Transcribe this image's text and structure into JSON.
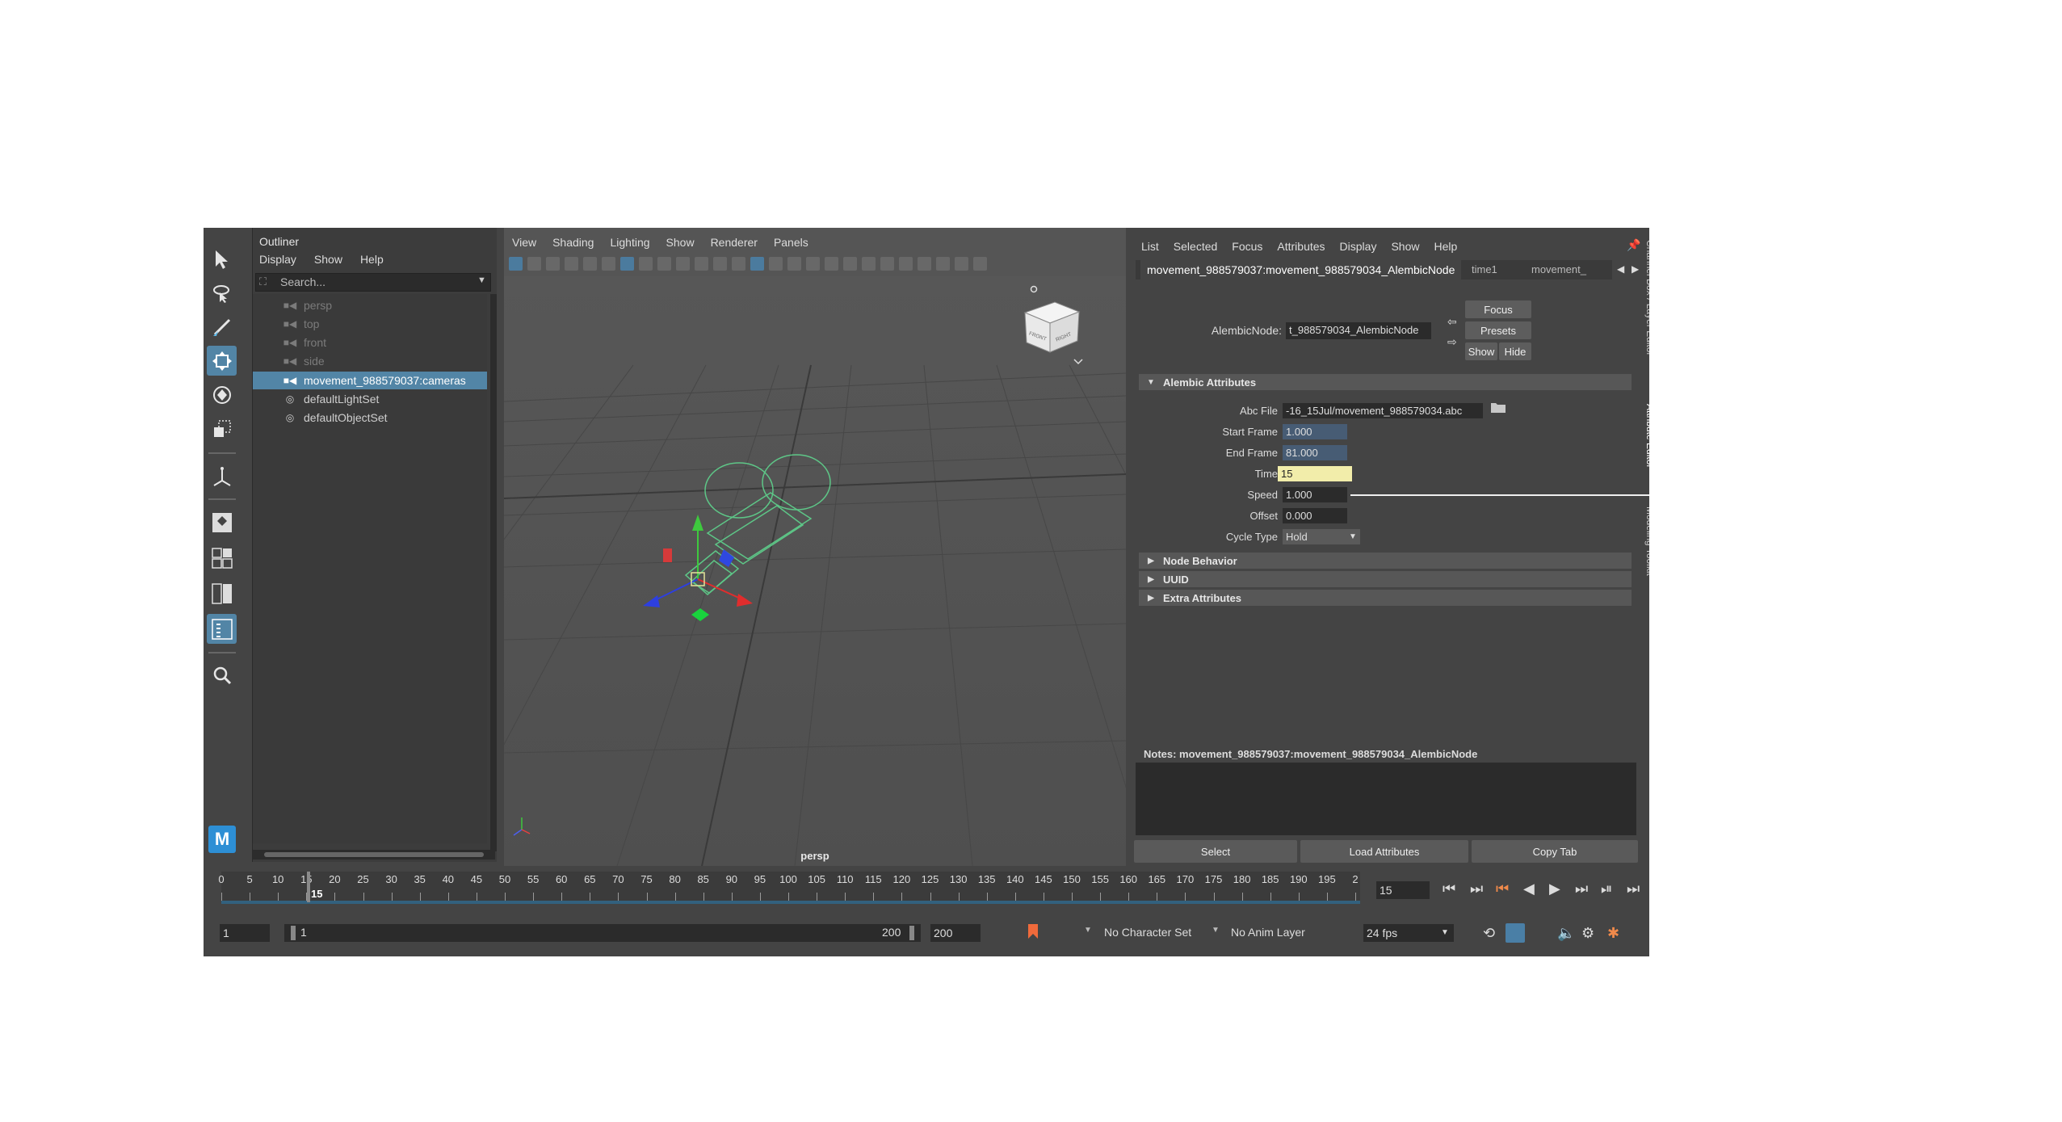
{
  "outliner": {
    "title": "Outliner",
    "menu": [
      "Display",
      "Show",
      "Help"
    ],
    "search_placeholder": "Search...",
    "items": [
      {
        "label": "persp",
        "icon": "camera-icon",
        "dim": true
      },
      {
        "label": "top",
        "icon": "camera-icon",
        "dim": true
      },
      {
        "label": "front",
        "icon": "camera-icon",
        "dim": true
      },
      {
        "label": "side",
        "icon": "camera-icon",
        "dim": true
      },
      {
        "label": "movement_988579037:cameras",
        "icon": "camera-icon",
        "selected": true
      },
      {
        "label": "defaultLightSet",
        "icon": "set-icon"
      },
      {
        "label": "defaultObjectSet",
        "icon": "set-icon"
      }
    ]
  },
  "viewport": {
    "menu": [
      "View",
      "Shading",
      "Lighting",
      "Show",
      "Renderer",
      "Panels"
    ],
    "camera_label": "persp",
    "viewcube_faces": [
      "FRONT",
      "RIGHT"
    ]
  },
  "attribute_editor": {
    "menu": [
      "List",
      "Selected",
      "Focus",
      "Attributes",
      "Display",
      "Show",
      "Help"
    ],
    "tabs": [
      "movement_988579037:movement_988579034_AlembicNode",
      "time1",
      "movement_"
    ],
    "node_label": "AlembicNode:",
    "node_value": "t_988579034_AlembicNode",
    "buttons": {
      "focus": "Focus",
      "presets": "Presets",
      "show": "Show",
      "hide": "Hide"
    },
    "sections": {
      "alembic": "Alembic Attributes",
      "node_behavior": "Node Behavior",
      "uuid": "UUID",
      "extra": "Extra Attributes"
    },
    "fields": {
      "abc_file": {
        "label": "Abc File",
        "value": "-16_15Jul/movement_988579034.abc"
      },
      "start_frame": {
        "label": "Start Frame",
        "value": "1.000"
      },
      "end_frame": {
        "label": "End Frame",
        "value": "81.000"
      },
      "time": {
        "label": "Time",
        "value": "15"
      },
      "speed": {
        "label": "Speed",
        "value": "1.000"
      },
      "offset": {
        "label": "Offset",
        "value": "0.000"
      },
      "cycle_type": {
        "label": "Cycle Type",
        "value": "Hold"
      }
    },
    "notes_label": "Notes:  movement_988579037:movement_988579034_AlembicNode",
    "bottom_buttons": [
      "Select",
      "Load Attributes",
      "Copy Tab"
    ],
    "side_tabs": [
      "Channel Box / Layer Editor",
      "Attribute Editor",
      "Modeling Toolkit"
    ]
  },
  "timeline": {
    "ticks": [
      "0",
      "5",
      "10",
      "15",
      "20",
      "25",
      "30",
      "35",
      "40",
      "45",
      "50",
      "55",
      "60",
      "65",
      "70",
      "75",
      "80",
      "85",
      "90",
      "95",
      "100",
      "105",
      "110",
      "115",
      "120",
      "125",
      "130",
      "135",
      "140",
      "145",
      "150",
      "155",
      "160",
      "165",
      "170",
      "175",
      "180",
      "185",
      "190",
      "195",
      "2"
    ],
    "current_frame_marker": "15",
    "current_frame": "15"
  },
  "range": {
    "start": "1",
    "inner_start": "1",
    "inner_end": "200",
    "end": "200",
    "character_set": "No Character Set",
    "anim_layer": "No Anim Layer",
    "fps": "24 fps"
  },
  "colors": {
    "selection": "#5285a6",
    "time_field": "#f2edaa",
    "frame_field": "#475c74"
  }
}
